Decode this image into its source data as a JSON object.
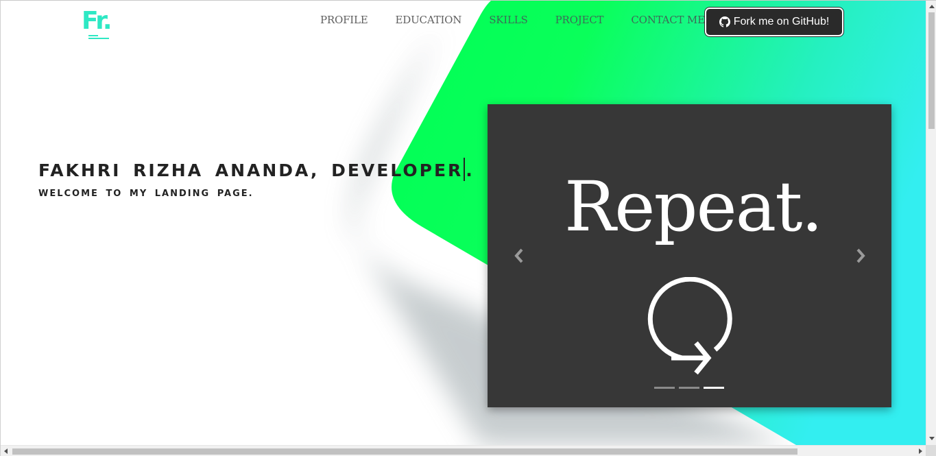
{
  "logo": {
    "text": "Fr."
  },
  "nav": {
    "items": [
      {
        "label": "PROFILE"
      },
      {
        "label": "EDUCATION"
      },
      {
        "label": "SKILLS"
      },
      {
        "label": "PROJECT"
      },
      {
        "label": "CONTACT ME"
      }
    ]
  },
  "github_button": {
    "label": "Fork me on GitHub!",
    "icon": "github-icon"
  },
  "hero": {
    "title_typed": "FAKHRI RIZHA  ANANDA, DEVELOPER",
    "title_after_caret": ".",
    "subtitle": "WELCOME TO MY LANDING PAGE."
  },
  "carousel": {
    "slide_text": "Repeat.",
    "slide_icon": "repeat-icon",
    "slide_count": 3,
    "active_index": 2,
    "prev_icon": "chevron-left-icon",
    "next_icon": "chevron-right-icon"
  },
  "colors": {
    "accent_green": "#00ff55",
    "accent_cyan": "#33eef0",
    "logo": "#2ee8c4",
    "carousel_bg": "#373737",
    "button_bg": "#2a2a2a"
  }
}
